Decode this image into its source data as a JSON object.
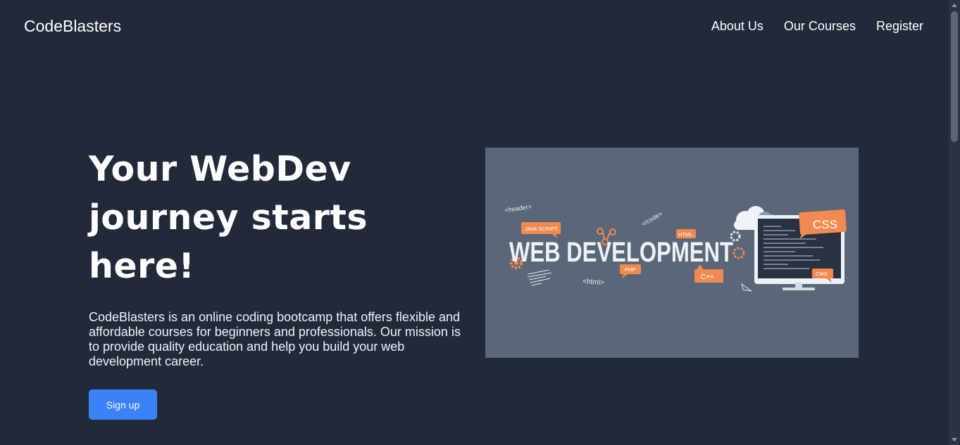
{
  "header": {
    "brand": "CodeBlasters",
    "nav": [
      {
        "label": "About Us"
      },
      {
        "label": "Our Courses"
      },
      {
        "label": "Register"
      }
    ]
  },
  "hero": {
    "title_line1": "Your WebDev",
    "title_line2": "journey starts here!",
    "description": "CodeBlasters is an online coding bootcamp that offers flexible and affordable courses for beginners and professionals. Our mission is to provide quality education and help you build your web development career.",
    "signup_label": "Sign up"
  },
  "banner": {
    "main_text": "WEB DEVELOPMENT",
    "tags": {
      "header": "<header>",
      "code": "</code>",
      "javascript": "JAVA SCRIPT",
      "html_badge": "HTML",
      "php": "PHP",
      "html_tag": "<html>",
      "cpp": "C++",
      "css": "CSS",
      "cms": "CMS"
    }
  },
  "colors": {
    "background": "#222a39",
    "accent": "#3b82f6",
    "banner_bg": "#5a6778",
    "banner_orange": "#f08a50"
  }
}
